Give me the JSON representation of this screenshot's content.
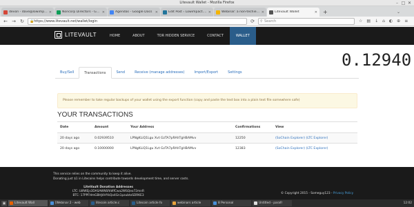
{
  "window": {
    "title": "Litevault Wallet - Mozilla Firefox"
  },
  "browser_tabs": [
    {
      "label": "devon - dave@lowimpact.org",
      "favicon_color": "#d44638",
      "active": false
    },
    {
      "label": "Noncorp Directors - Google",
      "favicon_color": "#0f9d58",
      "active": false
    },
    {
      "label": "Agendas - Google Docs",
      "favicon_color": "#4285f4",
      "active": false
    },
    {
      "label": "Edit Post ‹ Lowimpact.org — W",
      "favicon_color": "#21759b",
      "active": false
    },
    {
      "label": "Webinar: a non-techie's act",
      "favicon_color": "#f4b400",
      "active": false
    },
    {
      "label": "Litevault Wallet",
      "favicon_color": "#555555",
      "active": true
    }
  ],
  "url": "https://www.litevault.net/wallet/login",
  "search_placeholder": "Search",
  "site": {
    "logo": "LITEVAULT",
    "menu": [
      "HOME",
      "ABOUT",
      "TOR HIDDEN SERVICE",
      "CONTACT",
      "WALLET"
    ],
    "active_menu": "WALLET"
  },
  "balance": "0.12940",
  "subtabs": [
    "Buy/Sell",
    "Transactions",
    "Send",
    "Receive (manage addresses)",
    "Import/Export",
    "Settings"
  ],
  "active_subtab": "Transactions",
  "alert": "Please remember to take regular backups of your wallet using the export function (copy and paste the text box into a plain text file somewhere safe)",
  "transactions_heading": "YOUR TRANSACTIONS",
  "table": {
    "headers": [
      "Date",
      "Amount",
      "Your Address",
      "Confirmations",
      "View"
    ],
    "rows": [
      {
        "date": "20 days ago",
        "amount": "0.02939510",
        "address": "LPNgKLiQ1Lgu Xvt GzTA7pRAhTgHBAMvv",
        "confirmations": "12250",
        "view1": "(SoChain Explorer)",
        "view2": "(LTC Explorer)"
      },
      {
        "date": "20 days ago",
        "amount": "0.10000000",
        "address": "LPNgKLiQ1Lgu Xvt GzTA7pRAhTgHBAMvv",
        "confirmations": "12383",
        "view1": "(SoChain Explorer)",
        "view2": "(LTC Explorer)"
      }
    ]
  },
  "footer": {
    "notice": "This service relies on the community to keep it alive.",
    "notice2": "Donating just $1 in Litecoins helps contribute towards development time, and server costs.",
    "donate_title": "LiteVault Donation Addresses",
    "ltc": "LTC: LWWEjs3DASAWNSfkWfCwa2WSQeo72mnR",
    "btc": "BTC: 17PPFHmGBHJ4HYkQo4Gn1pzubtoSDRKE3",
    "copyright": "© Copyright 2015 - Someguy123 - ",
    "privacy": "Privacy Policy"
  },
  "taskbar": [
    {
      "label": "Litevault Wall",
      "color": "#e66000",
      "active": true
    },
    {
      "label": "[Webinar 2 - web",
      "color": "#4a90d9",
      "active": false
    },
    {
      "label": "litecoin article.c",
      "color": "#2a5d8a",
      "active": false
    },
    {
      "label": "Litecoin article fo",
      "color": "#2a5d8a",
      "active": false
    },
    {
      "label": "webinars article",
      "color": "#e8a33d",
      "active": false
    },
    {
      "label": "8 Personal",
      "color": "#4a90d9",
      "active": false
    },
    {
      "label": "Untitled - parafr",
      "color": "#dddddd",
      "active": false
    }
  ],
  "taskbar_time": "12:02"
}
